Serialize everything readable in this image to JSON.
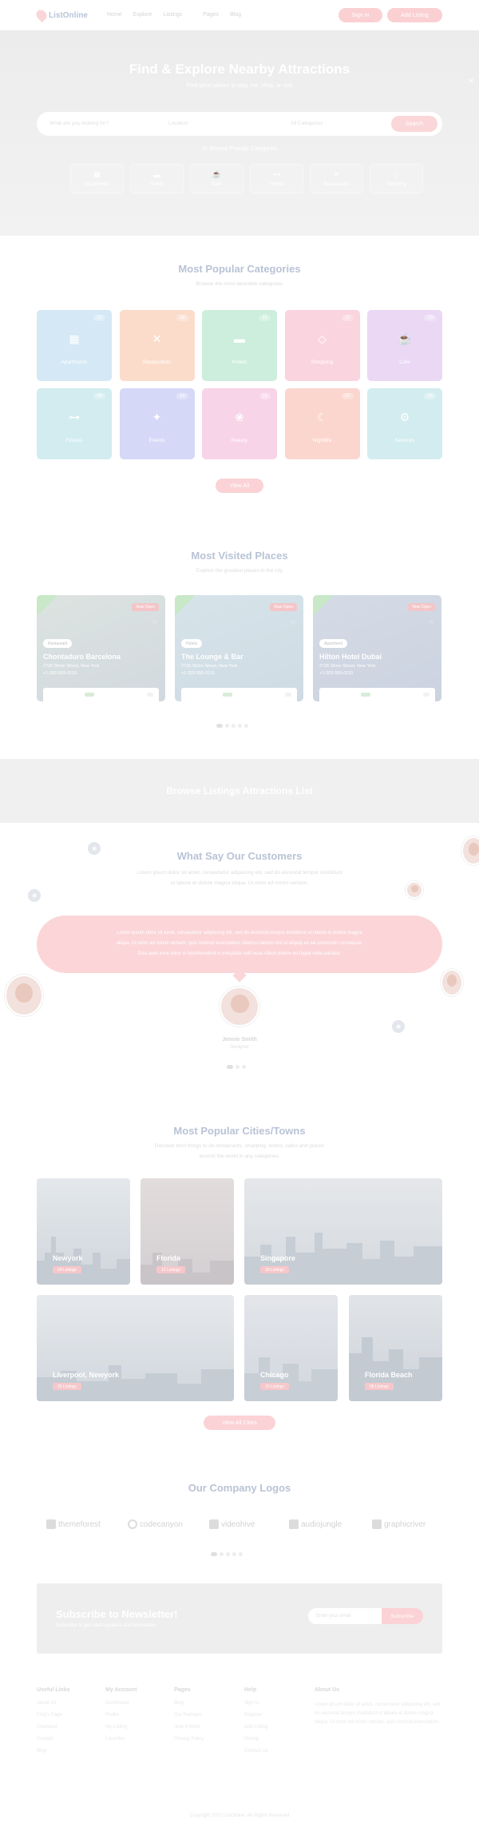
{
  "header": {
    "brand": "ListOnline",
    "nav": [
      "Home",
      "Explore",
      "Listings",
      "Pages",
      "Blog"
    ],
    "signin_label": "Sign In",
    "add_listing_label": "Add Listing"
  },
  "hero": {
    "title": "Find & Explore Nearby Attractions",
    "subtitle": "Find great places to stay, eat, shop, or visit",
    "search_what_placeholder": "What are you looking for?",
    "search_where_placeholder": "Location",
    "search_cat_placeholder": "All Categories",
    "search_button": "Search",
    "categories_title": "Or Browse Popular Categories",
    "categories": [
      "Apartments",
      "Hotels",
      "Cafe",
      "Fitness",
      "Restaurants",
      "Shopping"
    ]
  },
  "popular_categories": {
    "title": "Most Popular Categories",
    "subtitle": "Browse the most desirable categories",
    "items": [
      {
        "label": "Apartments",
        "count": "12",
        "color": "#d4e8f5"
      },
      {
        "label": "Restaurants",
        "count": "18",
        "color": "#fbdccb"
      },
      {
        "label": "Hotels",
        "count": "15",
        "color": "#cdeedd"
      },
      {
        "label": "Shopping",
        "count": "22",
        "color": "#fad4de"
      },
      {
        "label": "Cafe",
        "count": "10",
        "color": "#ead8f5"
      },
      {
        "label": "Fitness",
        "count": "09",
        "color": "#d2ecf0"
      },
      {
        "label": "Events",
        "count": "14",
        "color": "#d6d8f8"
      },
      {
        "label": "Beauty",
        "count": "11",
        "color": "#f8d4e8"
      },
      {
        "label": "Nightlife",
        "count": "07",
        "color": "#fbd6cf"
      },
      {
        "label": "Services",
        "count": "16",
        "color": "#d3ecef"
      }
    ],
    "button": "View All"
  },
  "visited_places": {
    "title": "Most Visited Places",
    "subtitle": "Explore the greatest places in the city",
    "items": [
      {
        "tag": "Now Open",
        "pill": "Restaurant",
        "name": "Chontaduro Barcelona",
        "addr": "2726 Shinn Street, New York",
        "phone": "+1-202-555-0110"
      },
      {
        "tag": "Now Open",
        "pill": "Hotels",
        "name": "The Lounge & Bar",
        "addr": "2726 Shinn Street, New York",
        "phone": "+1-202-555-0110"
      },
      {
        "tag": "Now Open",
        "pill": "Apartment",
        "name": "Hilton Hotel Dubai",
        "addr": "2726 Shinn Street, New York",
        "phone": "+1-202-555-0110"
      }
    ]
  },
  "band": {
    "text": "Browse Listings Attractions List"
  },
  "testimonials": {
    "title": "What Say Our Customers",
    "subtitle_1": "Lorem ipsum dolor sit amet, consectetur adipiscing elit, sed do eiusmod tempor incididunt",
    "subtitle_2": "ut labore et dolore magna aliqua. Ut enim ad minim veniam.",
    "quote_1": "Lorem ipsum dolor sit amet, consectetur adipiscing elit, sed do eiusmod tempor incididunt ut labore et dolore magna",
    "quote_2": "aliqua. Ut enim ad minim veniam, quis nostrud exercitation ullamco laboris nisi ut aliquip ex ea commodo consequat.",
    "quote_3": "Duis aute irure dolor in reprehenderit in voluptate velit esse cillum dolore eu fugiat nulla pariatur.",
    "author": "Jennie Smith",
    "role": "Designer"
  },
  "cities": {
    "title": "Most Popular Cities/Towns",
    "subtitle_1": "Discover best things to do restaurants, shopping, hotels, cafes and places",
    "subtitle_2": "around the world in any categories.",
    "items": [
      {
        "name": "Newyork",
        "count": "24 Listings"
      },
      {
        "name": "Florida",
        "count": "12 Listings"
      },
      {
        "name": "Singapore",
        "count": "18 Listings"
      },
      {
        "name": "Liverpool, Newyork",
        "count": "15 Listings"
      },
      {
        "name": "Chicago",
        "count": "10 Listings"
      },
      {
        "name": "Florida Beach",
        "count": "08 Listings"
      }
    ],
    "button": "View All Cities"
  },
  "logos": {
    "title": "Our Company Logos",
    "items": [
      "themeforest",
      "codecanyon",
      "videohive",
      "audiojungle",
      "graphicriver"
    ]
  },
  "newsletter": {
    "title": "Subscribe to Newsletter!",
    "subtitle": "Subscribe to get latest updates and information.",
    "placeholder": "Enter your email",
    "button": "Subscribe"
  },
  "footer": {
    "cols": [
      {
        "title": "Useful Links",
        "links": [
          "About Us",
          "FAQ's Page",
          "Checkout",
          "Contact",
          "Blog"
        ]
      },
      {
        "title": "My Account",
        "links": [
          "Dashboard",
          "Profile",
          "My Listing",
          "Favorites"
        ]
      },
      {
        "title": "Pages",
        "links": [
          "Blog",
          "Our Partners",
          "How It Work",
          "Privacy Policy"
        ]
      },
      {
        "title": "Help",
        "links": [
          "Sign In",
          "Register",
          "Add Listing",
          "Pricing",
          "Contact Us"
        ]
      }
    ],
    "about_title": "About Us",
    "about_text": "Lorem ipsum dolor sit amet, consectetur adipiscing elit, sed do eiusmod tempor incididunt ut labore et dolore magna aliqua. Ut enim ad minim veniam, quis nostrud exercitation.",
    "copyright": "Copyright 2021 ListOnline. All Rights Reserved"
  }
}
